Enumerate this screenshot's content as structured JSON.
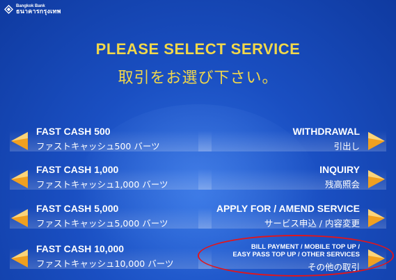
{
  "bank": {
    "name_en": "Bangkok Bank",
    "name_th": "ธนาคารกรุงเทพ"
  },
  "header": {
    "title_en": "PLEASE SELECT SERVICE",
    "title_jp": "取引をお選び下さい。"
  },
  "left_buttons": [
    {
      "en": "FAST CASH 500",
      "jp": "ファストキャッシュ500 バーツ"
    },
    {
      "en": "FAST CASH 1,000",
      "jp": "ファストキャッシュ1,000 バーツ"
    },
    {
      "en": "FAST CASH 5,000",
      "jp": "ファストキャッシュ5,000 バーツ"
    },
    {
      "en": "FAST CASH 10,000",
      "jp": "ファストキャッシュ10,000 バーツ"
    }
  ],
  "right_buttons": [
    {
      "en": "WITHDRAWAL",
      "jp": "引出し"
    },
    {
      "en": "INQUIRY",
      "jp": "残高照会"
    },
    {
      "en": "APPLY FOR / AMEND SERVICE",
      "jp": "サービス申込 / 内容変更"
    },
    {
      "en_line1": "BILL PAYMENT / MOBILE TOP UP /",
      "en_line2": "EASY PASS TOP UP / OTHER SERVICES",
      "jp": "その他の取引"
    }
  ],
  "colors": {
    "title": "#f2d84a",
    "arrow": "#f0a020",
    "highlight": "#e0161c"
  },
  "icons": {
    "logo": "lotus-diamond-icon",
    "left_arrow": "orange-left-arrow-icon",
    "right_arrow": "orange-right-arrow-icon"
  }
}
